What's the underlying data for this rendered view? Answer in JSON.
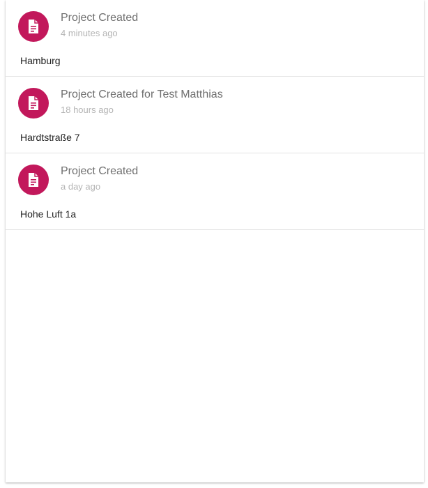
{
  "theme": {
    "accent": "#c2185b"
  },
  "activity": {
    "items": [
      {
        "icon": "document-icon",
        "title": "Project Created",
        "time": "4 minutes ago",
        "address": "Hamburg"
      },
      {
        "icon": "document-icon",
        "title": "Project Created for Test Matthias",
        "time": "18 hours ago",
        "address": "Hardtstraße 7"
      },
      {
        "icon": "document-icon",
        "title": "Project Created",
        "time": "a day ago",
        "address": "Hohe Luft 1a"
      }
    ]
  }
}
